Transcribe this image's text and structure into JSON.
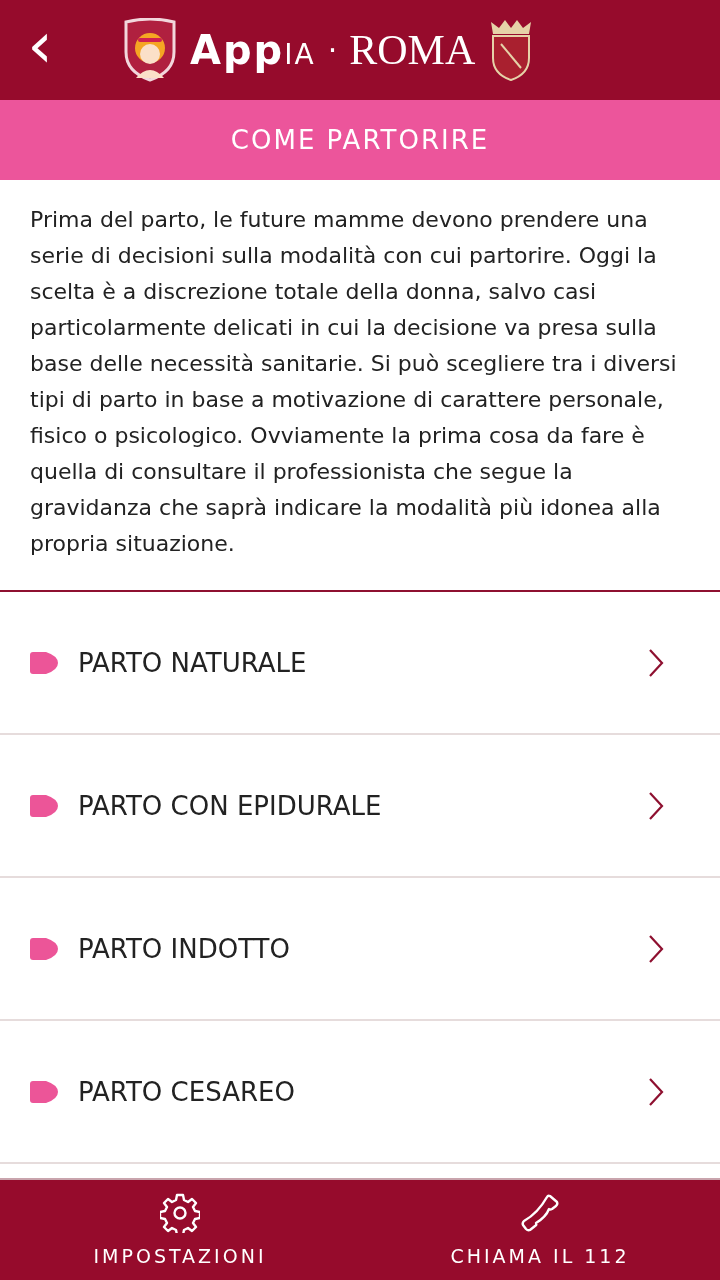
{
  "header": {
    "back": "‹",
    "logo_text": "**App**IA",
    "separator": "·",
    "city": "ROMA"
  },
  "title": "COME PARTORIRE",
  "intro": "Prima del parto, le future mamme devono prendere una serie di decisioni sulla modalità con cui partorire. Oggi la scelta è a discrezione totale della donna, salvo casi particolarmente delicati in cui la decisione va presa sulla base delle necessità sanitarie. Si può scegliere tra i diversi tipi di parto in base a motivazione di carattere personale, fisico o psicologico. Ovviamente la prima cosa da fare è quella di consultare il professionista che segue la gravidanza che saprà indicare la modalità più idonea alla propria situazione.",
  "items": [
    {
      "label": "PARTO NATURALE"
    },
    {
      "label": "PARTO CON EPIDURALE"
    },
    {
      "label": "PARTO INDOTTO"
    },
    {
      "label": "PARTO CESAREO"
    }
  ],
  "bottom_nav": [
    {
      "kind": "settings",
      "label": "IMPOSTAZIONI"
    },
    {
      "kind": "phone",
      "label": "CHIAMA IL 112"
    }
  ]
}
